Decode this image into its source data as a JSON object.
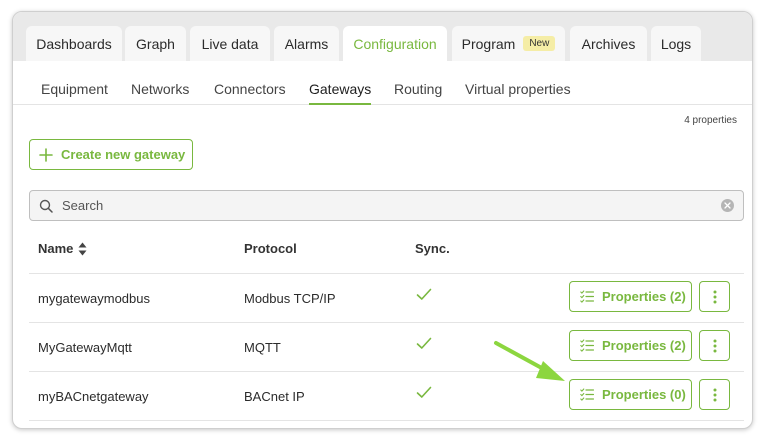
{
  "tabs": [
    {
      "label": "Dashboards",
      "active": false
    },
    {
      "label": "Graph",
      "active": false
    },
    {
      "label": "Live data",
      "active": false
    },
    {
      "label": "Alarms",
      "active": false
    },
    {
      "label": "Configuration",
      "active": true
    },
    {
      "label": "Program",
      "badge": "New",
      "active": false
    },
    {
      "label": "Archives",
      "active": false
    },
    {
      "label": "Logs",
      "active": false
    }
  ],
  "subtabs": [
    {
      "label": "Equipment",
      "active": false
    },
    {
      "label": "Networks",
      "active": false
    },
    {
      "label": "Connectors",
      "active": false
    },
    {
      "label": "Gateways",
      "active": true
    },
    {
      "label": "Routing",
      "active": false
    },
    {
      "label": "Virtual properties",
      "active": false
    }
  ],
  "count_label": "4 properties",
  "create_button": {
    "label": "Create new gateway"
  },
  "search": {
    "placeholder": "Search",
    "value": ""
  },
  "table": {
    "columns": [
      "Name",
      "Protocol",
      "Sync."
    ],
    "rows": [
      {
        "name": "mygatewaymodbus",
        "protocol": "Modbus TCP/IP",
        "synced": true,
        "properties_label": "Properties (2)"
      },
      {
        "name": "MyGatewayMqtt",
        "protocol": "MQTT",
        "synced": true,
        "properties_label": "Properties (2)"
      },
      {
        "name": "myBACnetgateway",
        "protocol": "BACnet IP",
        "synced": true,
        "properties_label": "Properties (0)"
      }
    ]
  },
  "colors": {
    "accent": "#79b83f",
    "arrow": "#8cd63f",
    "tabbar_bg": "#e9e9e9",
    "badge_bg": "#f5eda6"
  },
  "icons": {
    "create": "plus-icon",
    "search": "search-icon",
    "clear": "clear-icon",
    "sort": "sort-icon",
    "sync": "check-icon",
    "properties": "list-check-icon",
    "more": "more-vertical-icon",
    "annotation": "arrow-annotation"
  }
}
